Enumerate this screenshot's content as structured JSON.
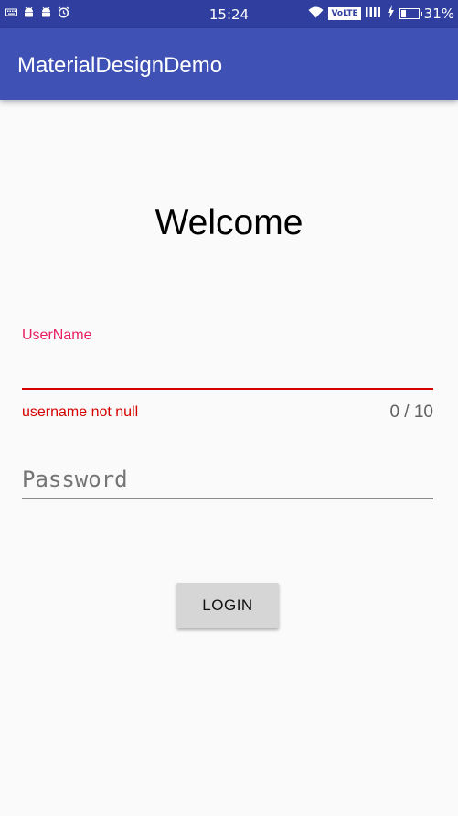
{
  "status_bar": {
    "time": "15:24",
    "network_label": "VoLTE",
    "battery_percent": "31%",
    "battery_level": 0.31,
    "left_icons": [
      "keyboard-icon",
      "android-icon",
      "android-icon",
      "alarm-icon"
    ],
    "right_icons": [
      "wifi-icon",
      "volte-icon",
      "signal-icon",
      "charging-icon",
      "battery-icon"
    ]
  },
  "app_bar": {
    "title": "MaterialDesignDemo",
    "color": "#3f51b5"
  },
  "main": {
    "welcome": "Welcome",
    "username": {
      "label": "UserName",
      "value": "",
      "error": "username not null",
      "counter": "0 / 10",
      "label_color": "#e91e63",
      "error_color": "#d50000"
    },
    "password": {
      "placeholder": "Password",
      "value": ""
    },
    "login_label": "LOGIN"
  }
}
